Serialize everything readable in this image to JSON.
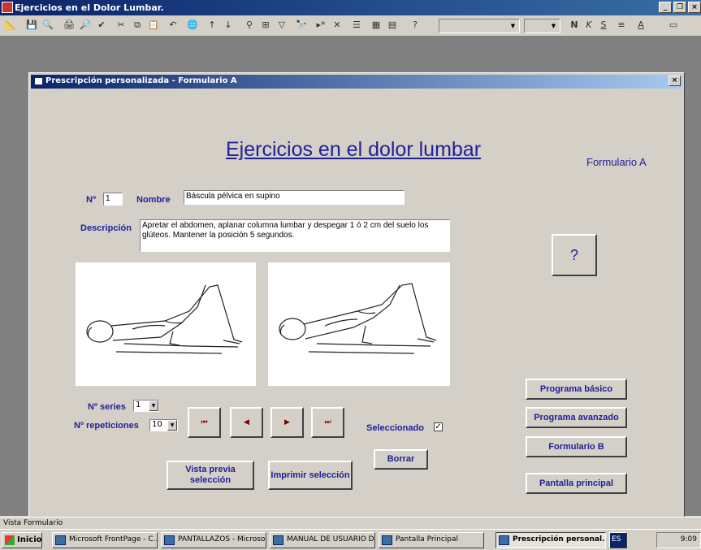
{
  "app": {
    "title": "Ejercicios en el Dolor Lumbar."
  },
  "form": {
    "window_title": "Prescripción personalizada - Formulario A",
    "heading": "Ejercicios en el dolor lumbar",
    "subheading": "Formulario A",
    "numero_label": "Nº",
    "numero_value": "1",
    "nombre_label": "Nombre",
    "nombre_value": "Báscula pélvica en supino",
    "descripcion_label": "Descripción",
    "descripcion_value": "Apretar el abdomen, aplanar columna lumbar y despegar 1 ó 2 cm del suelo los glúteos. Mantener la posición 5 segundos.",
    "help_label": "?",
    "series_label": "Nº series",
    "series_value": "1",
    "repeticiones_label": "Nº repeticiones",
    "repeticiones_value": "10",
    "seleccionado_label": "Seleccionado",
    "seleccionado_checked": true,
    "nav": {
      "first": "⏮",
      "prev": "◀",
      "next": "▶",
      "last": "⏭"
    },
    "buttons": {
      "vista_previa": "Vista previa selección",
      "imprimir": "Imprimir selección",
      "borrar": "Borrar",
      "programa_basico": "Programa básico",
      "programa_avanzado": "Programa avanzado",
      "formulario_b": "Formulario B",
      "pantalla_principal": "Pantalla principal"
    }
  },
  "status": {
    "text": "Vista Formulario"
  },
  "taskbar": {
    "start": "Inicio",
    "items": [
      "Microsoft FrontPage - C...",
      "PANTALLAZOS - Microso...",
      "MANUAL DE USUARIO D...",
      "Pantalla Principal",
      "Prescripción personal..."
    ],
    "lang": "ES",
    "time": "9:09"
  },
  "colors": {
    "label": "#1f1f99",
    "titlebar": "#0a246a",
    "nav_arrow": "#800000"
  }
}
